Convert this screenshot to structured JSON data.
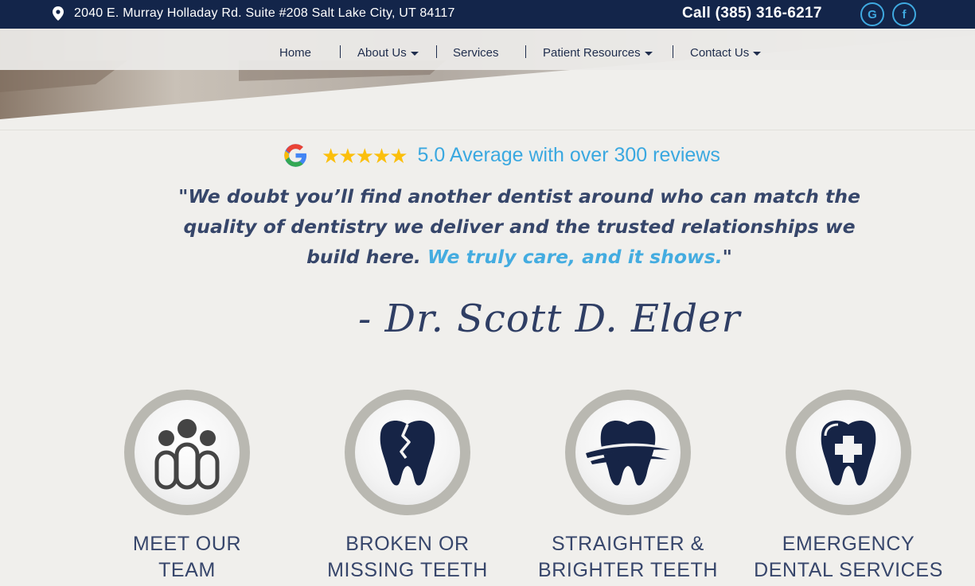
{
  "topbar": {
    "address": "2040 E. Murray Holladay Rd. Suite #208 Salt Lake City, UT 84117",
    "phone": "Call (385) 316-6217",
    "social": [
      {
        "name": "google-icon",
        "glyph": "G"
      },
      {
        "name": "facebook-icon",
        "glyph": "f"
      }
    ]
  },
  "nav": {
    "home": "Home",
    "about": "About Us",
    "services": "Services",
    "patient_resources": "Patient Resources",
    "contact": "Contact Us"
  },
  "reviews": {
    "stars": "★★★★★",
    "rating": 5.0,
    "text": "5.0 Average with over 300 reviews"
  },
  "quote": {
    "main": "\"We doubt you’ll find another dentist around who can match the quality of dentistry we deliver and the trusted relationships we build here. ",
    "highlight": "We truly care, and it shows.",
    "close": "\""
  },
  "signature": "- Dr. Scott D. Elder",
  "services": [
    {
      "line1": "MEET OUR",
      "line2": "TEAM",
      "icon": "team-icon"
    },
    {
      "line1": "BROKEN OR",
      "line2": "MISSING TEETH",
      "icon": "broken-tooth-icon"
    },
    {
      "line1": "STRAIGHTER &",
      "line2": "BRIGHTER TEETH",
      "icon": "smile-tooth-icon"
    },
    {
      "line1": "EMERGENCY",
      "line2": "DENTAL SERVICES",
      "icon": "emergency-tooth-icon"
    }
  ],
  "colors": {
    "navy": "#13254a",
    "accent_blue": "#3aa8e0",
    "star_gold": "#fbbf0c",
    "text_slate": "#37466b",
    "icon_navy": "#162446",
    "ring_gray": "#b9b8b1"
  }
}
